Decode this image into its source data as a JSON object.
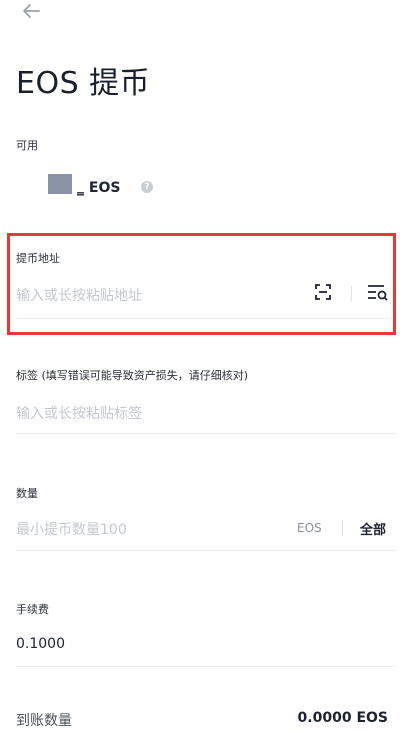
{
  "header": {
    "back_icon": "arrow-left-icon",
    "title": "EOS 提币"
  },
  "available": {
    "label": "可用",
    "balance": "̳ EOS",
    "info_icon": "info-circle-icon"
  },
  "address": {
    "label": "提币地址",
    "placeholder": "输入或长按粘贴地址",
    "scan_icon": "scan-icon",
    "address_book_icon": "address-book-icon"
  },
  "tag": {
    "label": "标签 (填写错误可能导致资产损失，请仔细核对)",
    "placeholder": "输入或长按粘贴标签"
  },
  "amount": {
    "label": "数量",
    "placeholder": "最小提币数量100",
    "unit": "EOS",
    "all_label": "全部"
  },
  "fee": {
    "label": "手续费",
    "value": "0.1000"
  },
  "arrival": {
    "label": "到账数量",
    "value": "0.0000 EOS"
  },
  "colors": {
    "highlight": "#e53935",
    "placeholder": "#c3c7cf",
    "text": "#1d2230"
  }
}
